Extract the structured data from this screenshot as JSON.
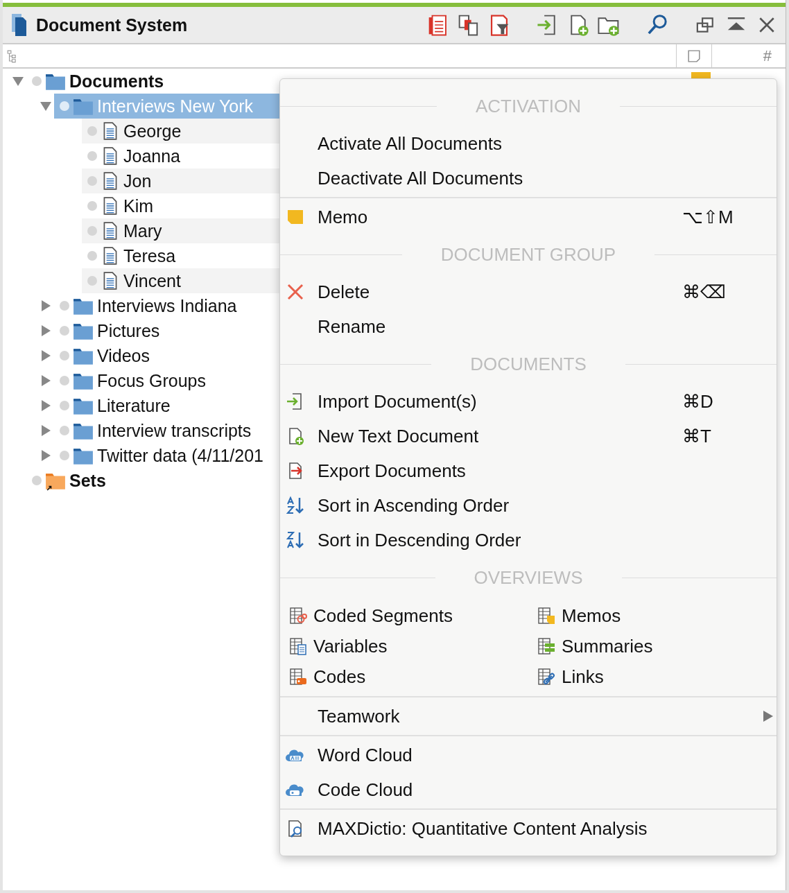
{
  "window": {
    "title": "Document System"
  },
  "header": {
    "count_header": "#"
  },
  "tree": [
    {
      "label": "Documents",
      "kind": "folder",
      "expanded": true,
      "selected": false,
      "memo": true,
      "children": [
        {
          "label": "Interviews New York",
          "kind": "folder",
          "expanded": true,
          "selected": true,
          "children": [
            {
              "label": "George",
              "kind": "document",
              "selected": false
            },
            {
              "label": "Joanna",
              "kind": "document",
              "selected": false
            },
            {
              "label": "Jon",
              "kind": "document",
              "selected": false
            },
            {
              "label": "Kim",
              "kind": "document",
              "selected": false
            },
            {
              "label": "Mary",
              "kind": "document",
              "selected": false
            },
            {
              "label": "Teresa",
              "kind": "document",
              "selected": false
            },
            {
              "label": "Vincent",
              "kind": "document",
              "selected": false
            }
          ]
        },
        {
          "label": "Interviews Indiana",
          "kind": "folder",
          "expanded": false,
          "selected": false
        },
        {
          "label": "Pictures",
          "kind": "folder",
          "expanded": false,
          "selected": false
        },
        {
          "label": "Videos",
          "kind": "folder",
          "expanded": false,
          "selected": false
        },
        {
          "label": "Focus Groups",
          "kind": "folder",
          "expanded": false,
          "selected": false
        },
        {
          "label": "Literature",
          "kind": "folder",
          "expanded": false,
          "selected": false
        },
        {
          "label": "Interview transcripts",
          "kind": "folder",
          "expanded": false,
          "selected": false
        },
        {
          "label": "Twitter data (4/11/201",
          "kind": "folder",
          "expanded": false,
          "selected": false
        }
      ]
    },
    {
      "label": "Sets",
      "kind": "sets",
      "selected": false
    }
  ],
  "context_menu": [
    {
      "kind": "header",
      "label": "ACTIVATION"
    },
    {
      "kind": "item",
      "label": "Activate All Documents"
    },
    {
      "kind": "item",
      "label": "Deactivate All Documents"
    },
    {
      "kind": "separator"
    },
    {
      "kind": "item",
      "label": "Memo",
      "shortcut": "⌥⇧M"
    },
    {
      "kind": "header",
      "label": "DOCUMENT GROUP"
    },
    {
      "kind": "item",
      "label": "Delete",
      "shortcut": "⌘⌫"
    },
    {
      "kind": "item",
      "label": "Rename"
    },
    {
      "kind": "header",
      "label": "DOCUMENTS"
    },
    {
      "kind": "item",
      "label": "Import Document(s)",
      "shortcut": "⌘D"
    },
    {
      "kind": "item",
      "label": "New Text Document",
      "shortcut": "⌘T"
    },
    {
      "kind": "item",
      "label": "Export Documents"
    },
    {
      "kind": "item",
      "label": "Sort in Ascending Order"
    },
    {
      "kind": "item",
      "label": "Sort in Descending Order"
    },
    {
      "kind": "header",
      "label": "OVERVIEWS"
    },
    {
      "kind": "grid",
      "items": [
        "Coded Segments",
        "Memos",
        "Variables",
        "Summaries",
        "Codes",
        "Links"
      ]
    },
    {
      "kind": "separator"
    },
    {
      "kind": "submenu",
      "label": "Teamwork"
    },
    {
      "kind": "separator"
    },
    {
      "kind": "item",
      "label": "Word Cloud"
    },
    {
      "kind": "item",
      "label": "Code Cloud"
    },
    {
      "kind": "separator"
    },
    {
      "kind": "item",
      "label": "MAXDictio: Quantitative Content Analysis"
    }
  ]
}
